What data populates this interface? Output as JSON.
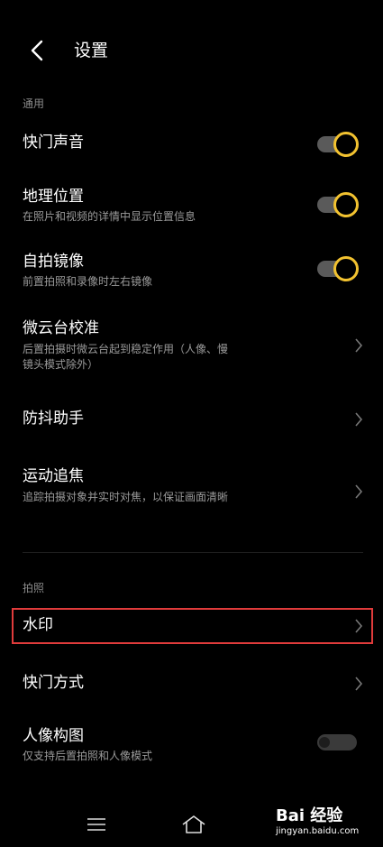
{
  "header": {
    "title": "设置"
  },
  "sections": {
    "general": "通用",
    "photo": "拍照"
  },
  "rows": [
    {
      "title": "快门声音",
      "subtitle": "",
      "control": "toggle-on"
    },
    {
      "title": "地理位置",
      "subtitle": "在照片和视频的详情中显示位置信息",
      "control": "toggle-on"
    },
    {
      "title": "自拍镜像",
      "subtitle": "前置拍照和录像时左右镜像",
      "control": "toggle-on"
    },
    {
      "title": "微云台校准",
      "subtitle": "后置拍摄时微云台起到稳定作用（人像、慢镜头模式除外）",
      "control": "chevron"
    },
    {
      "title": "防抖助手",
      "subtitle": "",
      "control": "chevron"
    },
    {
      "title": "运动追焦",
      "subtitle": "追踪拍摄对象并实时对焦，以保证画面清晰",
      "control": "chevron"
    },
    {
      "title": "水印",
      "subtitle": "",
      "control": "chevron"
    },
    {
      "title": "快门方式",
      "subtitle": "",
      "control": "chevron"
    },
    {
      "title": "人像构图",
      "subtitle": "仅支持后置拍照和人像模式",
      "control": "toggle-off"
    }
  ],
  "watermark": {
    "logo": "Bai 经验",
    "url": "jingyan.baidu.com"
  },
  "colors": {
    "accent": "#f2c230",
    "highlight": "#e03b3b"
  }
}
